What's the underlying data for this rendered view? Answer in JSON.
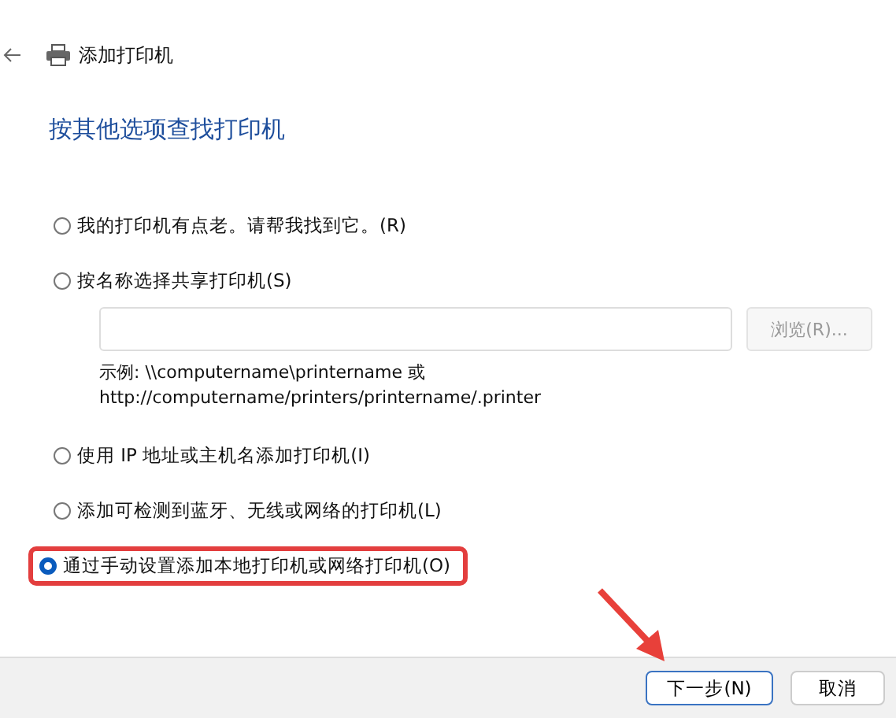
{
  "window": {
    "title": "添加打印机"
  },
  "heading": "按其他选项查找打印机",
  "options": [
    {
      "label": "我的打印机有点老。请帮我找到它。(R)",
      "selected": false,
      "highlighted": false
    },
    {
      "label": "按名称选择共享打印机(S)",
      "selected": false,
      "highlighted": false,
      "kind": "share"
    },
    {
      "label": "使用 IP 地址或主机名添加打印机(I)",
      "selected": false,
      "highlighted": false
    },
    {
      "label": "添加可检测到蓝牙、无线或网络的打印机(L)",
      "selected": false,
      "highlighted": false
    },
    {
      "label": "通过手动设置添加本地打印机或网络打印机(O)",
      "selected": true,
      "highlighted": true
    }
  ],
  "share": {
    "browse_button": "浏览(R)...",
    "browse_disabled": true,
    "example": [
      "示例: \\\\computername\\printername 或",
      "http://computername/printers/printername/.printer"
    ]
  },
  "buttons": [
    {
      "label": "下一步(N)",
      "default": true
    },
    {
      "label": "取消",
      "default": false
    }
  ]
}
